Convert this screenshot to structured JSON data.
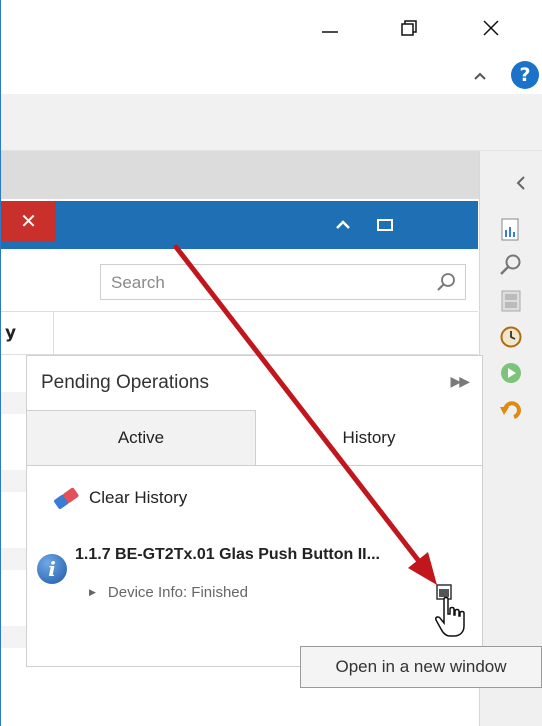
{
  "window": {
    "minimize_icon": "minimize-icon",
    "restore_icon": "restore-icon",
    "close_icon": "close-icon"
  },
  "ribbon": {
    "collapse_icon": "chevron-up-icon",
    "help_icon": "help-icon",
    "help_color": "#1a73c8"
  },
  "right_panel": {
    "collapse_icon": "chevron-left-icon",
    "icons": [
      "report-icon",
      "search-icon",
      "panel-icon",
      "clock-icon",
      "play-icon",
      "undo-icon"
    ]
  },
  "panel_header": {
    "color": "#1f6fb5",
    "close_color": "#c9302c"
  },
  "search": {
    "placeholder": "Search"
  },
  "table": {
    "column_fragment": "y"
  },
  "pending": {
    "title": "Pending Operations",
    "tabs": [
      {
        "label": "Active"
      },
      {
        "label": "History"
      }
    ],
    "clear_label": "Clear History",
    "item": {
      "name": "1.1.7 BE-GT2Tx.01 Glas Push Button II...",
      "status": "Device Info: Finished"
    }
  },
  "tooltip": {
    "text": "Open in a new window"
  },
  "annotation": {
    "color": "#c0161c"
  }
}
